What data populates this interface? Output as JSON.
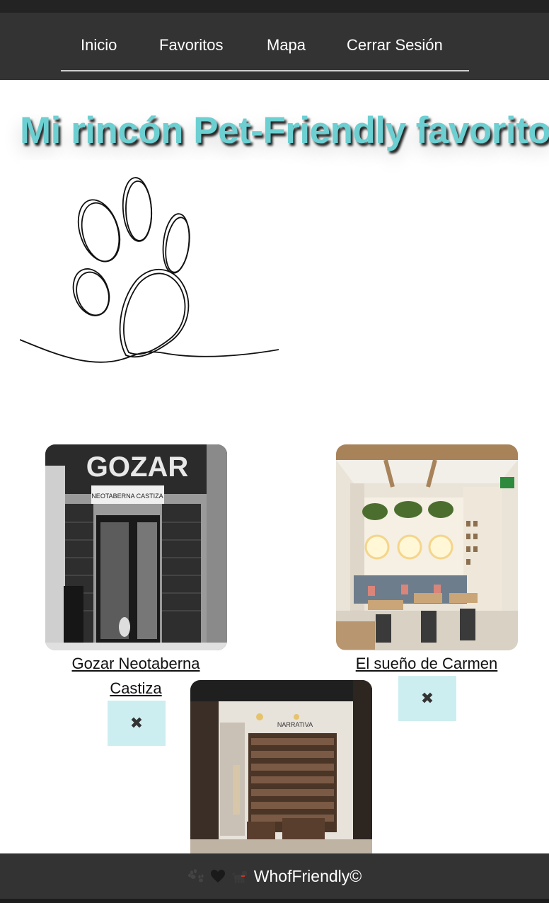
{
  "nav": {
    "items": [
      {
        "label": "Inicio"
      },
      {
        "label": "Favoritos"
      },
      {
        "label": "Mapa"
      },
      {
        "label": "Cerrar Sesión"
      }
    ]
  },
  "page": {
    "title": "Mi rincón Pet-Friendly favorito"
  },
  "favorites": [
    {
      "name": "Gozar Neotaberna Castiza",
      "sign_text": "GOZAR",
      "sign_subtext": "NEOTABERNA CASTIZA",
      "remove_label": "✖"
    },
    {
      "name": "El sueño de Carmen",
      "remove_label": "✖"
    },
    {
      "name": "",
      "sign_text": "NARRATIVA"
    }
  ],
  "footer": {
    "text": "WhofFriendly©",
    "icons": [
      "paw-prints-icon",
      "black-heart-icon",
      "dog-icon"
    ]
  },
  "colors": {
    "nav_bg": "#333333",
    "title": "#6ccfd1",
    "remove_bg": "#cdeef0",
    "footer_bg": "#333333"
  }
}
